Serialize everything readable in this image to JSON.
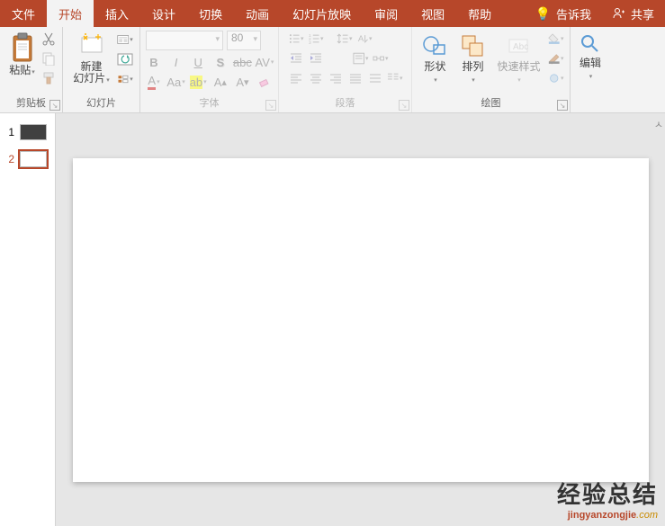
{
  "tabs": {
    "file": "文件",
    "home": "开始",
    "insert": "插入",
    "design": "设计",
    "transitions": "切换",
    "animations": "动画",
    "slideshow": "幻灯片放映",
    "review": "审阅",
    "view": "视图",
    "help": "帮助",
    "tellme": "告诉我",
    "share": "共享"
  },
  "ribbon": {
    "clipboard": {
      "paste": "粘贴",
      "label": "剪贴板"
    },
    "slides": {
      "newslide": "新建\n幻灯片",
      "label": "幻灯片"
    },
    "font": {
      "label": "字体",
      "size_value": "80"
    },
    "paragraph": {
      "label": "段落"
    },
    "drawing": {
      "shapes": "形状",
      "arrange": "排列",
      "quickstyles": "快速样式",
      "label": "绘图"
    },
    "editing": {
      "edit": "编辑"
    }
  },
  "thumbs": {
    "items": [
      {
        "num": "1"
      },
      {
        "num": "2"
      }
    ]
  },
  "watermark": {
    "main": "经验总结",
    "sub_domain": "jingyanzongjie",
    "sub_tld": ".com"
  }
}
